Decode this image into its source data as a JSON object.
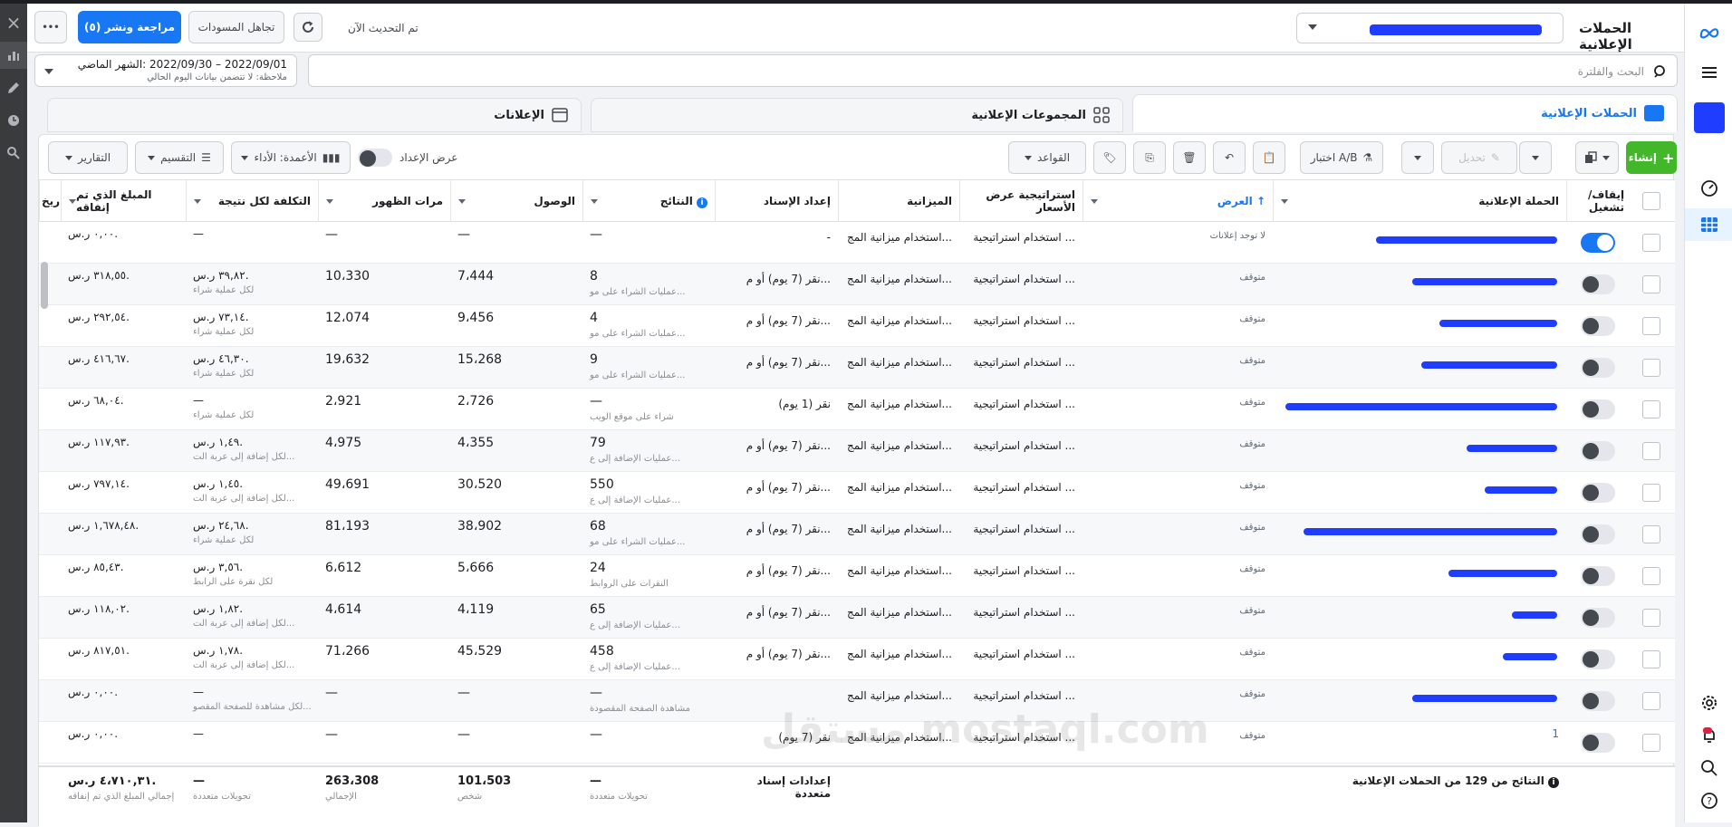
{
  "app": {
    "title": "الحملات الإعلانية",
    "account_dropdown": "",
    "close_label": "×"
  },
  "topbar": {
    "review_publish": "مراجعة ونشر (٥)",
    "ignore_drafts": "تجاهل المسودات",
    "updated": "تم التحديث الآن",
    "more": "•••"
  },
  "filter": {
    "date_range": "2022/09/01 – 2022/09/30 :الشهر الماضي",
    "date_note": "ملاحظة: لا تتضمن بيانات اليوم الحالي",
    "search_placeholder": "البحث والفلترة"
  },
  "tabs": [
    {
      "label": "الحملات الإعلانية"
    },
    {
      "label": "المجموعات الإعلانية"
    },
    {
      "label": "الإعلانات"
    }
  ],
  "toolbar": {
    "create": "إنشاء",
    "edit": "تحديل",
    "ab_test": "اختبار A/B",
    "rules": "القواعد",
    "view_setup": "عرض الإعداد",
    "columns": "الأعمدة: الأداء",
    "breakdown": "التقسيم",
    "reports": "التقارير"
  },
  "columns": [
    "إيقاف/ تشغيل",
    "الحملة الإعلانية",
    "العرض",
    "استراتيجية عرض الأسعار",
    "الميزانية",
    "إعداد الإسناد",
    "النتائج",
    "الوصول",
    "مرات الظهور",
    "التكلفة لكل نتيجة",
    "المبلغ الذي تم إنفاقه",
    "تاريخ"
  ],
  "rows": [
    {
      "toggle": "on",
      "name": "",
      "delivery": "لا توجد إعلانات",
      "strategy": "استخدام استراتيجية ...",
      "budget": "استخدام ميزانية المج...",
      "attribution": "-",
      "results": "—",
      "results_sub": "",
      "reach": "—",
      "impressions": "—",
      "cost": "—",
      "cost_sub": "",
      "spent": "٠,٠٠ ر.س."
    },
    {
      "toggle": "off",
      "name": "",
      "delivery": "متوقف",
      "strategy": "استخدام استراتيجية ...",
      "budget": "استخدام ميزانية المج...",
      "attribution": "نقر (7 يوم) أو م...",
      "results": "8",
      "results_sub": "عمليات الشراء على مو...",
      "reach": "7،444",
      "impressions": "10،330",
      "cost": "٣٩,٨٢ ر.س.",
      "cost_sub": "لكل عملية شراء",
      "spent": "٣١٨,٥٥ ر.س."
    },
    {
      "toggle": "off",
      "name": "",
      "delivery": "متوقف",
      "strategy": "استخدام استراتيجية ...",
      "budget": "استخدام ميزانية المج...",
      "attribution": "نقر (7 يوم) أو م...",
      "results": "4",
      "results_sub": "عمليات الشراء على مو...",
      "reach": "9،456",
      "impressions": "12،074",
      "cost": "٧٣,١٤ ر.س.",
      "cost_sub": "لكل عملية شراء",
      "spent": "٢٩٢,٥٤ ر.س."
    },
    {
      "toggle": "off",
      "name": "",
      "delivery": "متوقف",
      "strategy": "استخدام استراتيجية ...",
      "budget": "استخدام ميزانية المج...",
      "attribution": "نقر (7 يوم) أو م...",
      "results": "9",
      "results_sub": "عمليات الشراء على مو...",
      "reach": "15،268",
      "impressions": "19،632",
      "cost": "٤٦,٣٠ ر.س.",
      "cost_sub": "لكل عملية شراء",
      "spent": "٤١٦,٦٧ ر.س."
    },
    {
      "toggle": "off",
      "name": "",
      "delivery": "متوقف",
      "strategy": "استخدام استراتيجية ...",
      "budget": "استخدام ميزانية المج...",
      "attribution": "نقر (1 يوم)",
      "results": "—",
      "results_sub": "شراء على موقع الويب",
      "reach": "2،726",
      "impressions": "2،921",
      "cost": "—",
      "cost_sub": "لكل عملية شراء",
      "spent": "٦٨,٠٤ ر.س."
    },
    {
      "toggle": "off",
      "name": "",
      "delivery": "متوقف",
      "strategy": "استخدام استراتيجية ...",
      "budget": "استخدام ميزانية المج...",
      "attribution": "نقر (7 يوم) أو م...",
      "results": "79",
      "results_sub": "عمليات الإضافة إلى ع...",
      "reach": "4،355",
      "impressions": "4،975",
      "cost": "١,٤٩ ر.س.",
      "cost_sub": "لكل إضافة إلى عربة الت...",
      "spent": "١١٧,٩٣ ر.س."
    },
    {
      "toggle": "off",
      "name": "",
      "delivery": "متوقف",
      "strategy": "استخدام استراتيجية ...",
      "budget": "استخدام ميزانية المج...",
      "attribution": "نقر (7 يوم) أو م...",
      "results": "550",
      "results_sub": "عمليات الإضافة إلى ع...",
      "reach": "30،520",
      "impressions": "49،691",
      "cost": "١,٤٥ ر.س.",
      "cost_sub": "لكل إضافة إلى عربة الت...",
      "spent": "٧٩٧,١٤ ر.س."
    },
    {
      "toggle": "off",
      "name": "",
      "delivery": "متوقف",
      "strategy": "استخدام استراتيجية ...",
      "budget": "استخدام ميزانية المج...",
      "attribution": "نقر (7 يوم) أو م...",
      "results": "68",
      "results_sub": "عمليات الشراء على مو...",
      "reach": "38،902",
      "impressions": "81،193",
      "cost": "٢٤,٦٨ ر.س.",
      "cost_sub": "لكل عملية شراء",
      "spent": "١,٦٧٨,٤٨ ر.س."
    },
    {
      "toggle": "off",
      "name": "",
      "delivery": "متوقف",
      "strategy": "استخدام استراتيجية ...",
      "budget": "استخدام ميزانية المج...",
      "attribution": "نقر (7 يوم) أو م...",
      "results": "24",
      "results_sub": "النقرات على الروابط",
      "reach": "5،666",
      "impressions": "6،612",
      "cost": "٣,٥٦ ر.س.",
      "cost_sub": "لكل نقرة على الرابط",
      "spent": "٨٥,٤٣ ر.س."
    },
    {
      "toggle": "off",
      "name": "",
      "delivery": "متوقف",
      "strategy": "استخدام استراتيجية ...",
      "budget": "استخدام ميزانية المج...",
      "attribution": "نقر (7 يوم) أو م...",
      "results": "65",
      "results_sub": "عمليات الإضافة إلى ع...",
      "reach": "4،119",
      "impressions": "4،614",
      "cost": "١,٨٢ ر.س.",
      "cost_sub": "لكل إضافة إلى عربة الت...",
      "spent": "١١٨,٠٢ ر.س."
    },
    {
      "toggle": "off",
      "name": "",
      "delivery": "متوقف",
      "strategy": "استخدام استراتيجية ...",
      "budget": "استخدام ميزانية المج...",
      "attribution": "نقر (7 يوم) أو م...",
      "results": "458",
      "results_sub": "عمليات الإضافة إلى ع...",
      "reach": "45،529",
      "impressions": "71،266",
      "cost": "١,٧٨ ر.س.",
      "cost_sub": "لكل إضافة إلى عربة الت...",
      "spent": "٨١٧,٥١ ر.س."
    },
    {
      "toggle": "off",
      "name": "",
      "delivery": "متوقف",
      "strategy": "استخدام استراتيجية ...",
      "budget": "استخدام ميزانية المج...",
      "attribution": "",
      "results": "—",
      "results_sub": "مشاهدة الصفحة المقصودة",
      "reach": "—",
      "impressions": "—",
      "cost": "—",
      "cost_sub": "لكل مشاهدة للصفحة المقصو...",
      "spent": "٠,٠٠ ر.س."
    },
    {
      "toggle": "off",
      "name": "1",
      "delivery": "متوقف",
      "strategy": "استخدام استراتيجية ...",
      "budget": "استخدام ميزانية المج...",
      "attribution": "نقر (7 يوم)",
      "results": "—",
      "results_sub": "",
      "reach": "—",
      "impressions": "—",
      "cost": "—",
      "cost_sub": "",
      "spent": "٠,٠٠ ر.س."
    }
  ],
  "footer": {
    "summary": "النتائج من 129 من الحملات الإعلانية",
    "attribution": "إعدادات إسناد متعددة",
    "results": "—",
    "results_sub": "تحويلات متعددة",
    "reach": "101،503",
    "reach_sub": "شخص",
    "impressions": "263،308",
    "impressions_sub": "الإجمالي",
    "cost": "—",
    "cost_sub": "تحويلات متعددة",
    "spent": "٤،٧١٠,٣١ ر.س.",
    "spent_sub": "إجمالي المبلغ الذي تم إنفاقه"
  },
  "watermark": "مستقل mostaql.com",
  "colors": {
    "accent": "#1877f2",
    "create": "#42b72a"
  }
}
